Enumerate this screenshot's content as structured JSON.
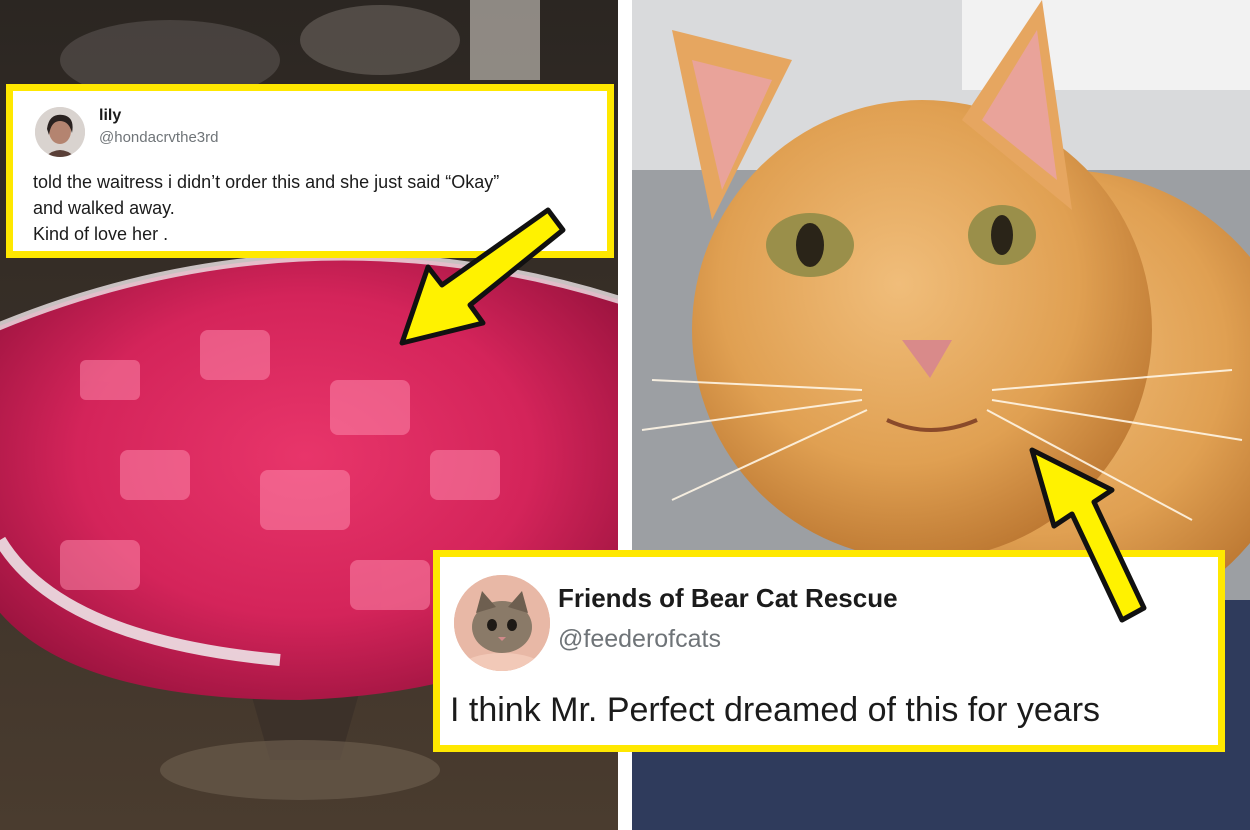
{
  "colors": {
    "highlight_yellow": "#ffe800",
    "arrow_yellow": "#fff200",
    "drink_pink": "#d4245a",
    "cat_orange": "#e0a052",
    "handle_gray": "#6f7478"
  },
  "left_tweet": {
    "name": "lily",
    "handle": "@hondacrvthe3rd",
    "text_lines": [
      "told the waitress i didn’t order this and she just said “Okay”",
      "and walked away.",
      "Kind of love her ."
    ]
  },
  "right_tweet": {
    "name": "Friends of Bear Cat Rescue",
    "handle": "@feederofcats",
    "text": "I think Mr. Perfect dreamed of this for years"
  },
  "icons": {
    "left_arrow": "arrow-down-left-icon",
    "right_arrow": "arrow-up-left-icon"
  }
}
